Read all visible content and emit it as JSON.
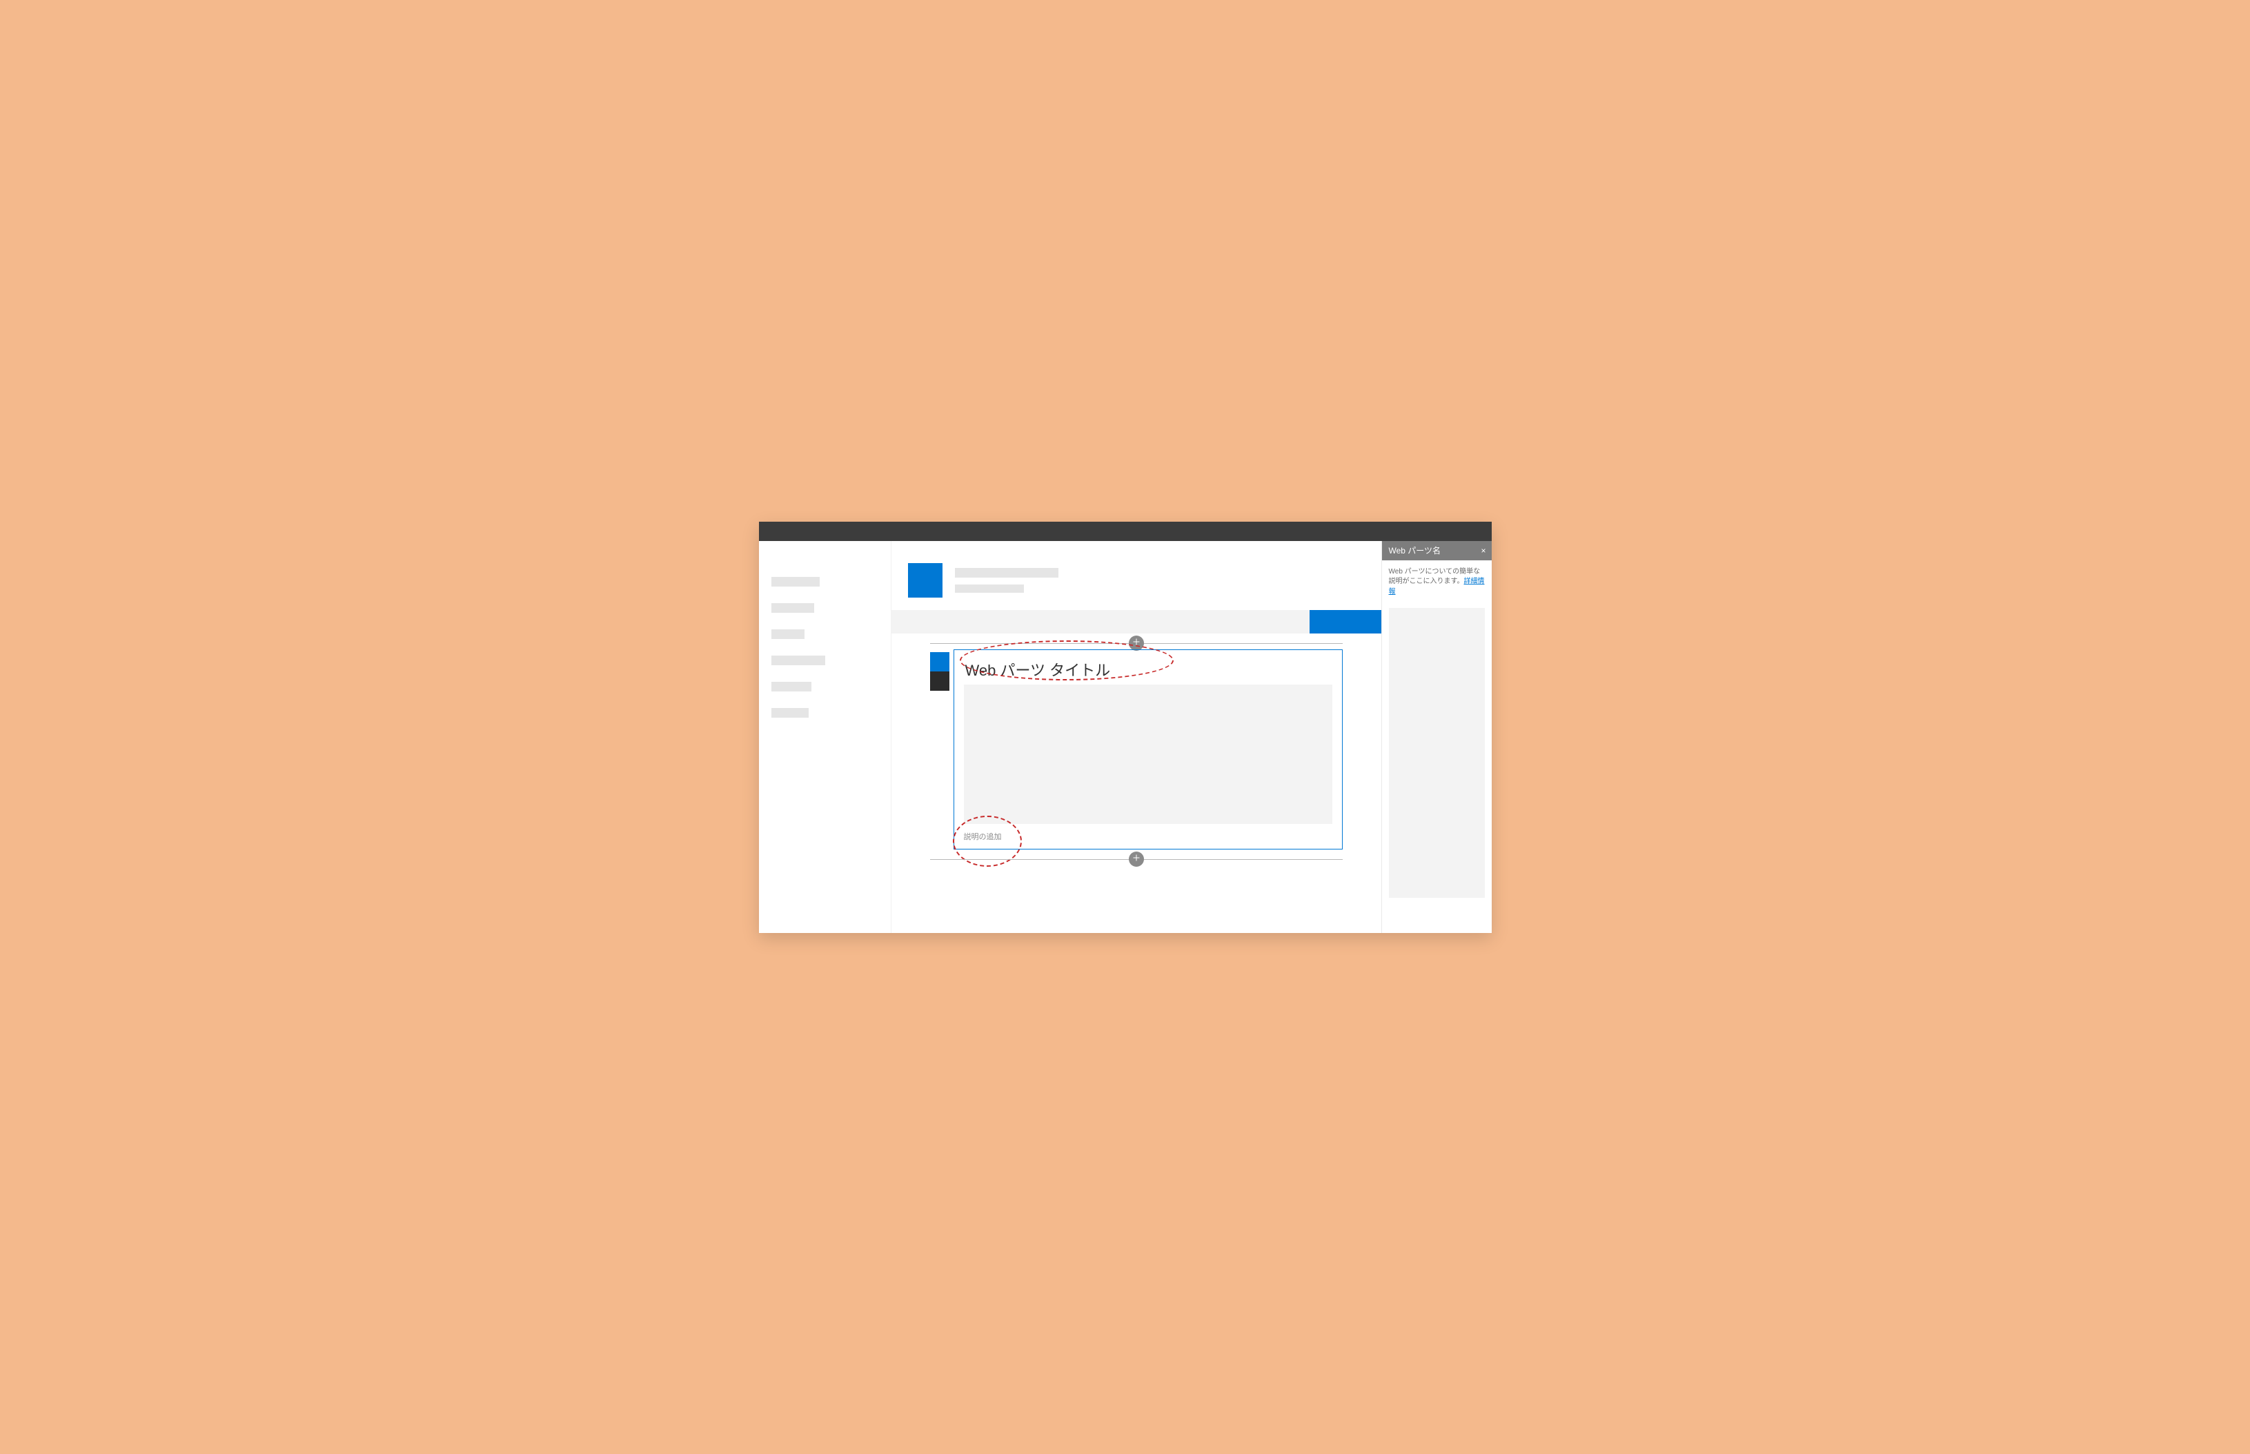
{
  "webpart": {
    "title": "Web パーツ タイトル",
    "caption_placeholder": "説明の追加"
  },
  "property_pane": {
    "header_title": "Web パーツ名",
    "close_glyph": "×",
    "description": "Web パーツについての簡単な説明がここに入ります。",
    "learn_more": "詳細情報"
  },
  "colors": {
    "accent": "#0078d4",
    "annotation": "#c72a2a"
  }
}
